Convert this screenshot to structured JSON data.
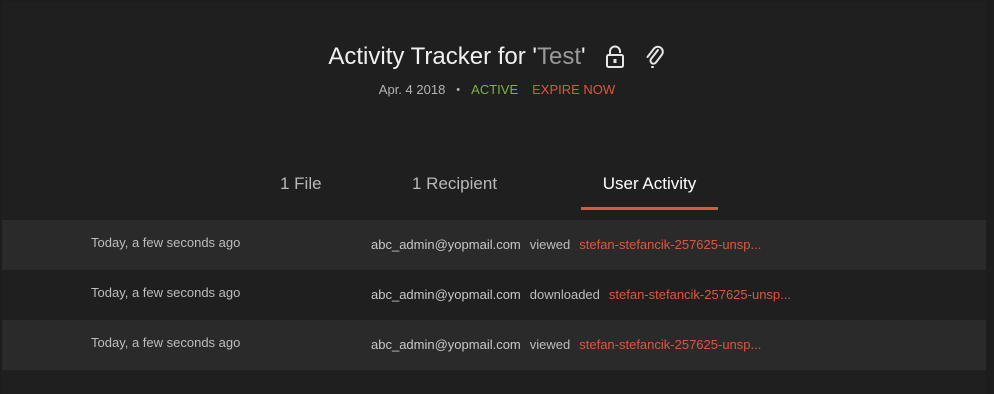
{
  "header": {
    "title_prefix": "Activity Tracker for '",
    "title_name": "Test",
    "title_suffix": "'",
    "icons": [
      "lock-icon",
      "paperclip-icon"
    ],
    "date": "Apr. 4 2018",
    "separator": "•",
    "status": "ACTIVE",
    "expire_label": "EXPIRE NOW"
  },
  "tabs": [
    {
      "label": "1 File"
    },
    {
      "label": "1 Recipient"
    },
    {
      "label": "User Activity",
      "active": true
    }
  ],
  "activity": [
    {
      "time": "Today, a few seconds ago",
      "email": "abc_admin@yopmail.com",
      "action": "viewed",
      "file": "stefan-stefancik-257625-unsp..."
    },
    {
      "time": "Today, a few seconds ago",
      "email": "abc_admin@yopmail.com",
      "action": "downloaded",
      "file": "stefan-stefancik-257625-unsp..."
    },
    {
      "time": "Today, a few seconds ago",
      "email": "abc_admin@yopmail.com",
      "action": "viewed",
      "file": "stefan-stefancik-257625-unsp..."
    }
  ],
  "colors": {
    "accent": "#e0563c",
    "active_status": "#7cb342",
    "background": "#1f1f1f",
    "row_alt": "#2a2a2a"
  }
}
